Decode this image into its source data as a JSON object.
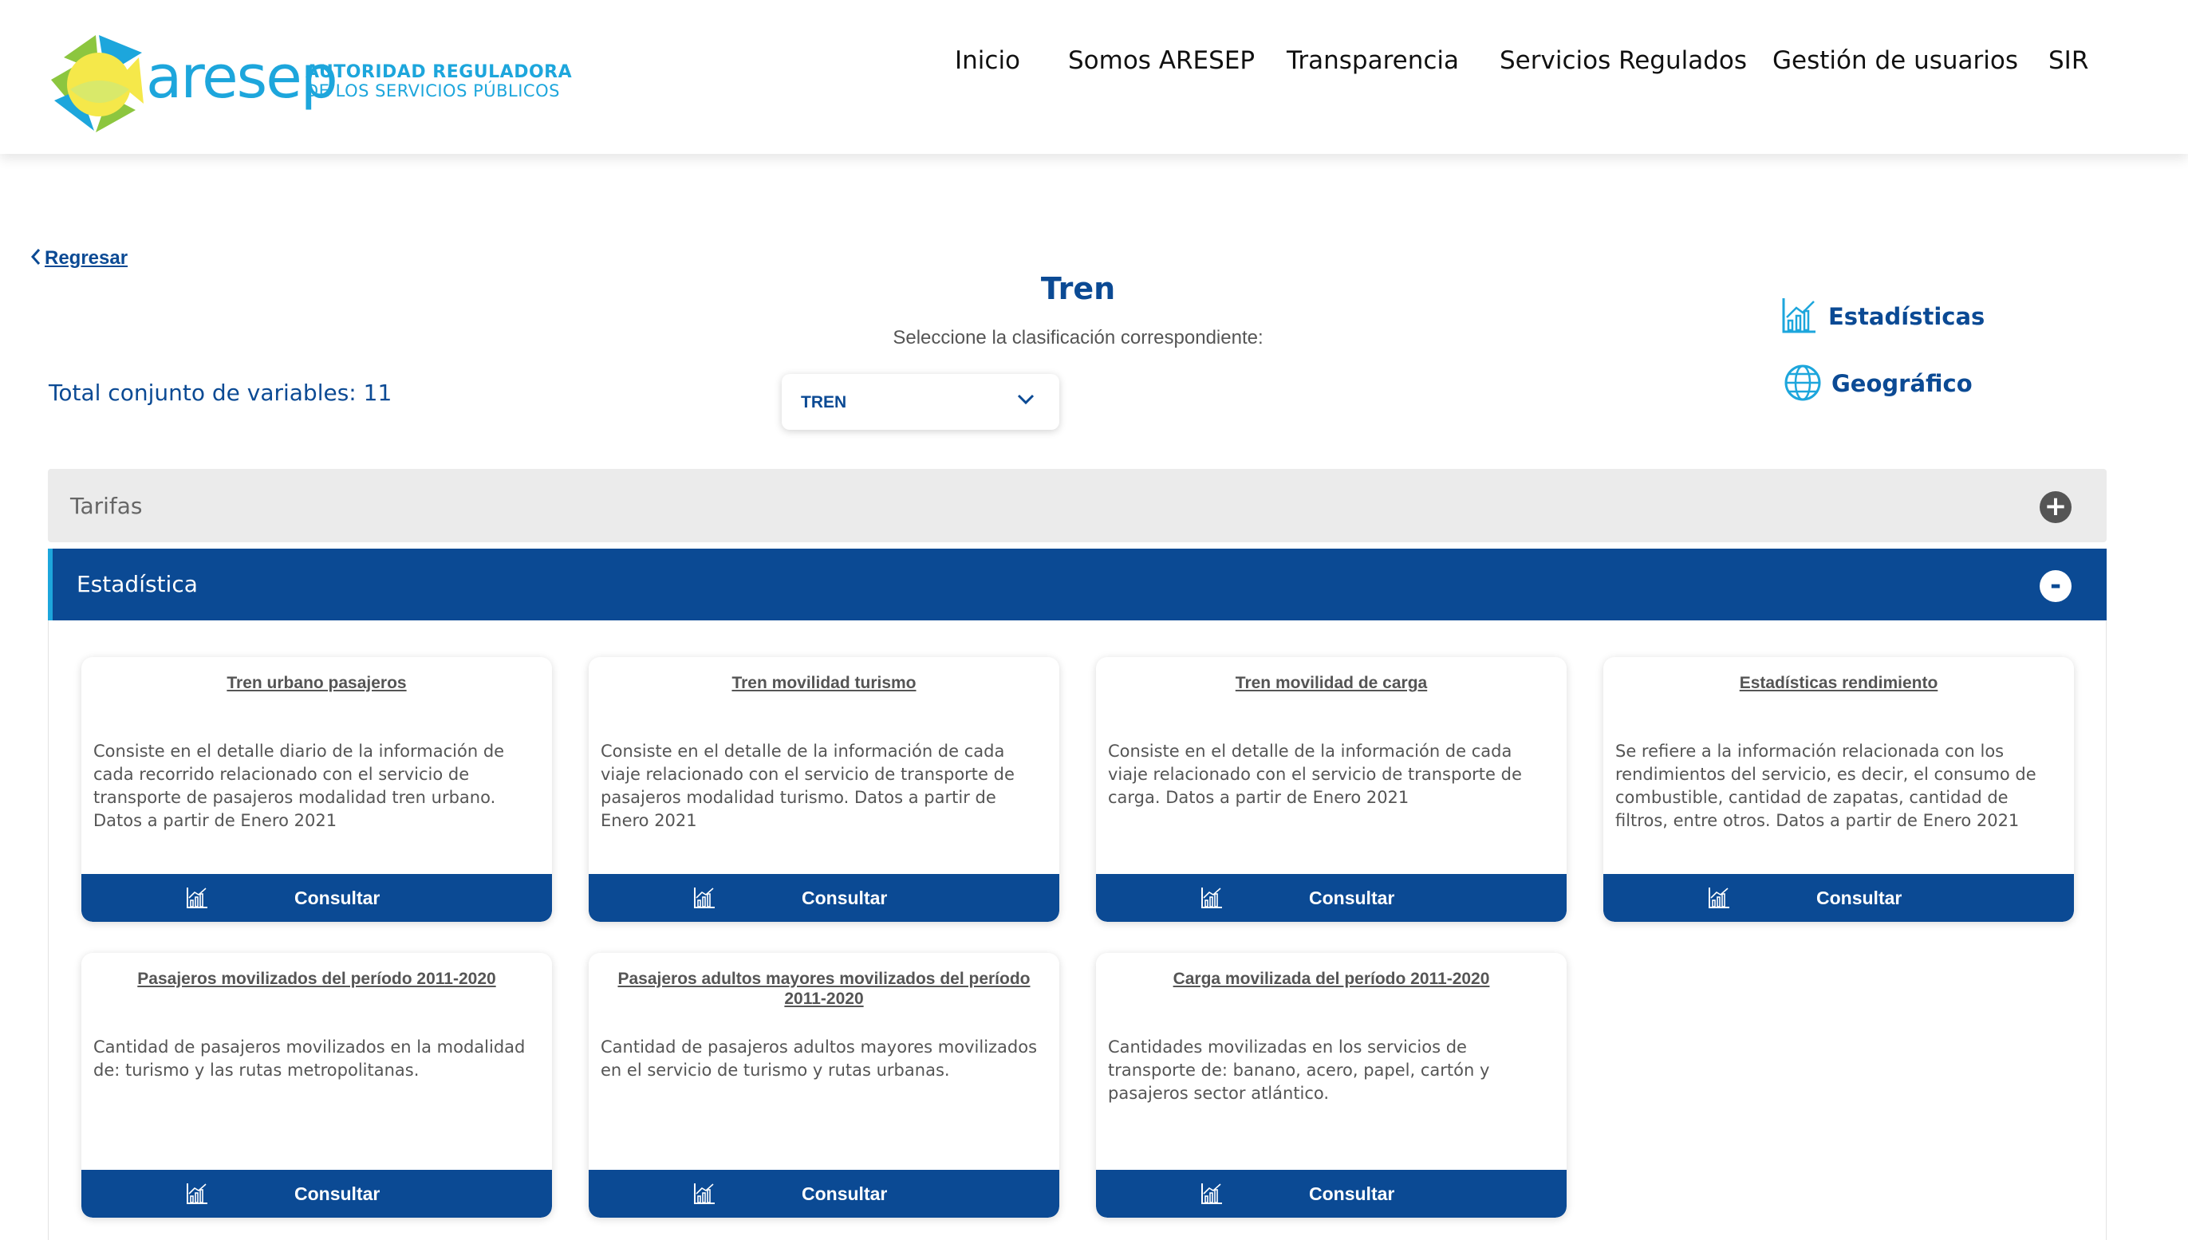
{
  "header": {
    "logo": {
      "word": "aresep",
      "line1": "AUTORIDAD REGULADORA",
      "line2": "DE LOS SERVICIOS PÚBLICOS"
    },
    "nav": [
      "Inicio",
      "Somos ARESEP",
      "Transparencia",
      "Servicios Regulados",
      "Gestión de usuarios",
      "SIR"
    ]
  },
  "back_label": "Regresar",
  "title": "Tren",
  "subtitle": "Seleccione la clasificación correspondiente:",
  "select": {
    "value": "TREN"
  },
  "total_label": "Total conjunto de variables: 11",
  "side_links": {
    "stats": "Estadísticas",
    "geo": "Geográfico"
  },
  "accordion": {
    "closed": {
      "label": "Tarifas",
      "icon": "+"
    },
    "open": {
      "label": "Estadística",
      "icon": "-"
    }
  },
  "cards": [
    {
      "title": "Tren urbano pasajeros",
      "desc": "Consiste en el detalle diario de la información de cada recorrido relacionado con el servicio de transporte de pasajeros modalidad tren urbano. Datos a partir de Enero 2021",
      "button": "Consultar"
    },
    {
      "title": "Tren movilidad turismo",
      "desc": "Consiste en el detalle de la información de cada viaje relacionado con el servicio de transporte de pasajeros modalidad turismo. Datos a partir de Enero 2021",
      "button": "Consultar"
    },
    {
      "title": "Tren movilidad de carga",
      "desc": "Consiste en el detalle de la información de cada viaje relacionado con el servicio de transporte de carga. Datos a partir de Enero 2021",
      "button": "Consultar"
    },
    {
      "title": "Estadísticas rendimiento",
      "desc": "Se refiere a la información relacionada con los rendimientos del servicio, es decir, el consumo de combustible, cantidad de zapatas, cantidad de filtros, entre otros. Datos a partir de Enero 2021",
      "button": "Consultar"
    },
    {
      "title": "Pasajeros movilizados del período 2011-2020",
      "desc": "Cantidad de pasajeros movilizados en la modalidad de: turismo y las rutas metropolitanas.",
      "button": "Consultar"
    },
    {
      "title": "Pasajeros adultos mayores movilizados del período 2011-2020",
      "desc": "Cantidad de pasajeros adultos mayores movilizados en el servicio de turismo y rutas urbanas.",
      "button": "Consultar"
    },
    {
      "title": "Carga movilizada del período 2011-2020",
      "desc": "Cantidades movilizadas en los servicios de transporte de: banano, acero, papel, cartón y pasajeros sector atlántico.",
      "button": "Consultar"
    }
  ],
  "colors": {
    "primary": "#0b4a94",
    "accent": "#1da6dc",
    "logo_green": "#8cc63f",
    "logo_yellow": "#f5e84a"
  }
}
